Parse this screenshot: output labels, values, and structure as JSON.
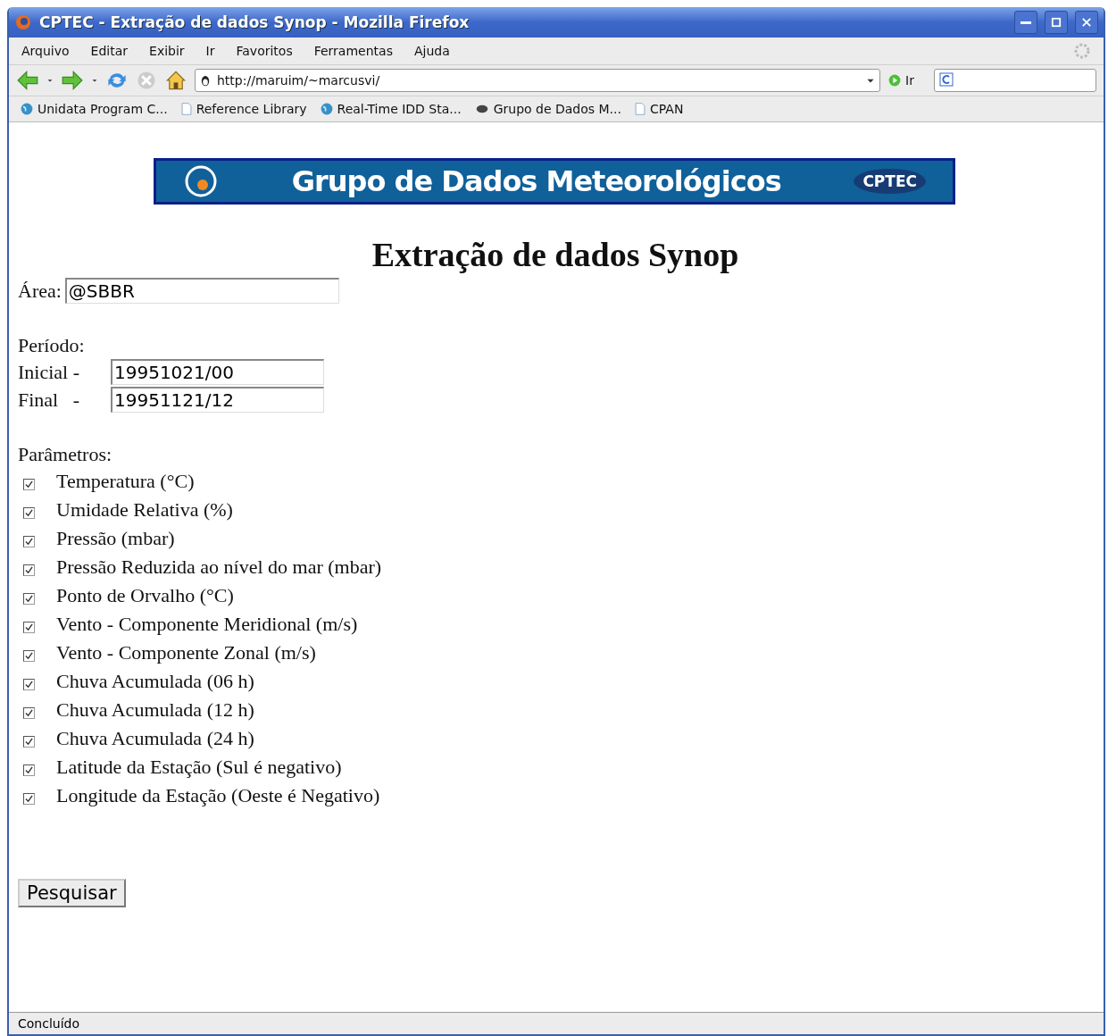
{
  "window": {
    "title": "CPTEC - Extração de dados Synop - Mozilla Firefox"
  },
  "menu": [
    "Arquivo",
    "Editar",
    "Exibir",
    "Ir",
    "Favoritos",
    "Ferramentas",
    "Ajuda"
  ],
  "address_bar": {
    "value": "http://maruim/~marcusvi/",
    "go_label": "Ir"
  },
  "bookmarks": [
    {
      "label": "Unidata Program C...",
      "kind": "globe"
    },
    {
      "label": "Reference Library",
      "kind": "page"
    },
    {
      "label": "Real-Time IDD Sta...",
      "kind": "globe"
    },
    {
      "label": "Grupo de Dados M...",
      "kind": "badge"
    },
    {
      "label": "CPAN",
      "kind": "page"
    }
  ],
  "banner": {
    "title": "Grupo de Dados Meteorológicos",
    "logo_text": "CPTEC"
  },
  "heading": "Extração de dados Synop",
  "area": {
    "label": "Área:",
    "value": "@SBBR"
  },
  "period": {
    "label": "Período:",
    "fields": [
      {
        "label": "Inicial -",
        "value": "19951021/00"
      },
      {
        "label": "Final   -",
        "value": "19951121/12"
      }
    ]
  },
  "parameters": {
    "label": "Parâmetros:",
    "items": [
      {
        "label": "Temperatura (°C)",
        "checked": true
      },
      {
        "label": "Umidade Relativa (%)",
        "checked": true
      },
      {
        "label": "Pressão (mbar)",
        "checked": true
      },
      {
        "label": "Pressão Reduzida ao nível do mar (mbar)",
        "checked": true
      },
      {
        "label": "Ponto de Orvalho (°C)",
        "checked": true
      },
      {
        "label": "Vento - Componente Meridional (m/s)",
        "checked": true
      },
      {
        "label": "Vento - Componente Zonal (m/s)",
        "checked": true
      },
      {
        "label": "Chuva Acumulada (06 h)",
        "checked": true
      },
      {
        "label": "Chuva Acumulada (12 h)",
        "checked": true
      },
      {
        "label": "Chuva Acumulada (24 h)",
        "checked": true
      },
      {
        "label": "Latitude da Estação (Sul é negativo)",
        "checked": true
      },
      {
        "label": "Longitude da Estação (Oeste é Negativo)",
        "checked": true
      }
    ]
  },
  "submit": "Pesquisar",
  "status_bar": "Concluído"
}
